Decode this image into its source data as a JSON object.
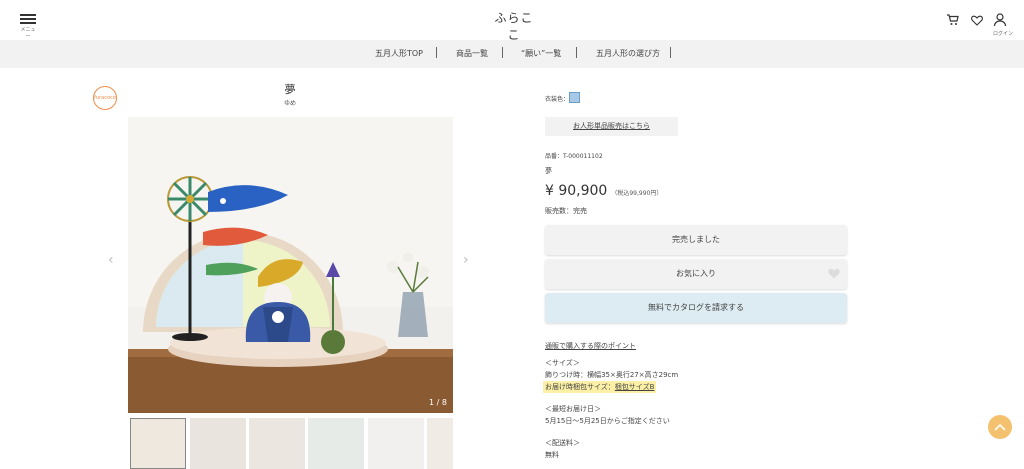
{
  "header": {
    "menu_label": "メニュー",
    "logo_main": "ふらここ",
    "logo_sub": "furacoco",
    "login_label": "ログイン"
  },
  "subnav": {
    "items": [
      "五月人形TOP",
      "商品一覧",
      "“願い”一覧",
      "五月人形の選び方"
    ]
  },
  "product": {
    "badge": "furacoco",
    "title": "夢",
    "reading": "ゆめ",
    "image_counter": "1 / 8",
    "color_label": "衣装色：",
    "doll_only_link": "お人形単品販売はこちら",
    "item_no": "品番：T-000011102",
    "name": "夢",
    "price": "¥ 90,900",
    "price_tax": "（税込99,990円）",
    "sales_status": "販売数：完売",
    "soldout_button": "完売しました",
    "favorite_button": "お気に入り",
    "catalog_button": "無料でカタログを請求する",
    "points_link": "通販で購入する際のポイント",
    "size_heading": "＜サイズ＞",
    "size_value": "飾りつけ時：横幅35×奥行27×高さ29cm",
    "package_label": "お届け時梱包サイズ：",
    "package_link": "梱包サイズB",
    "delivery_heading": "＜最短お届け日＞",
    "delivery_value": "5月15日～5月25日からご指定ください",
    "shipping_heading": "＜配送料＞",
    "shipping_value": "無料"
  },
  "colors": {
    "accent_orange": "#f4c16e",
    "catalog_bg": "#dcecf2",
    "highlight": "#fbf0a6"
  }
}
